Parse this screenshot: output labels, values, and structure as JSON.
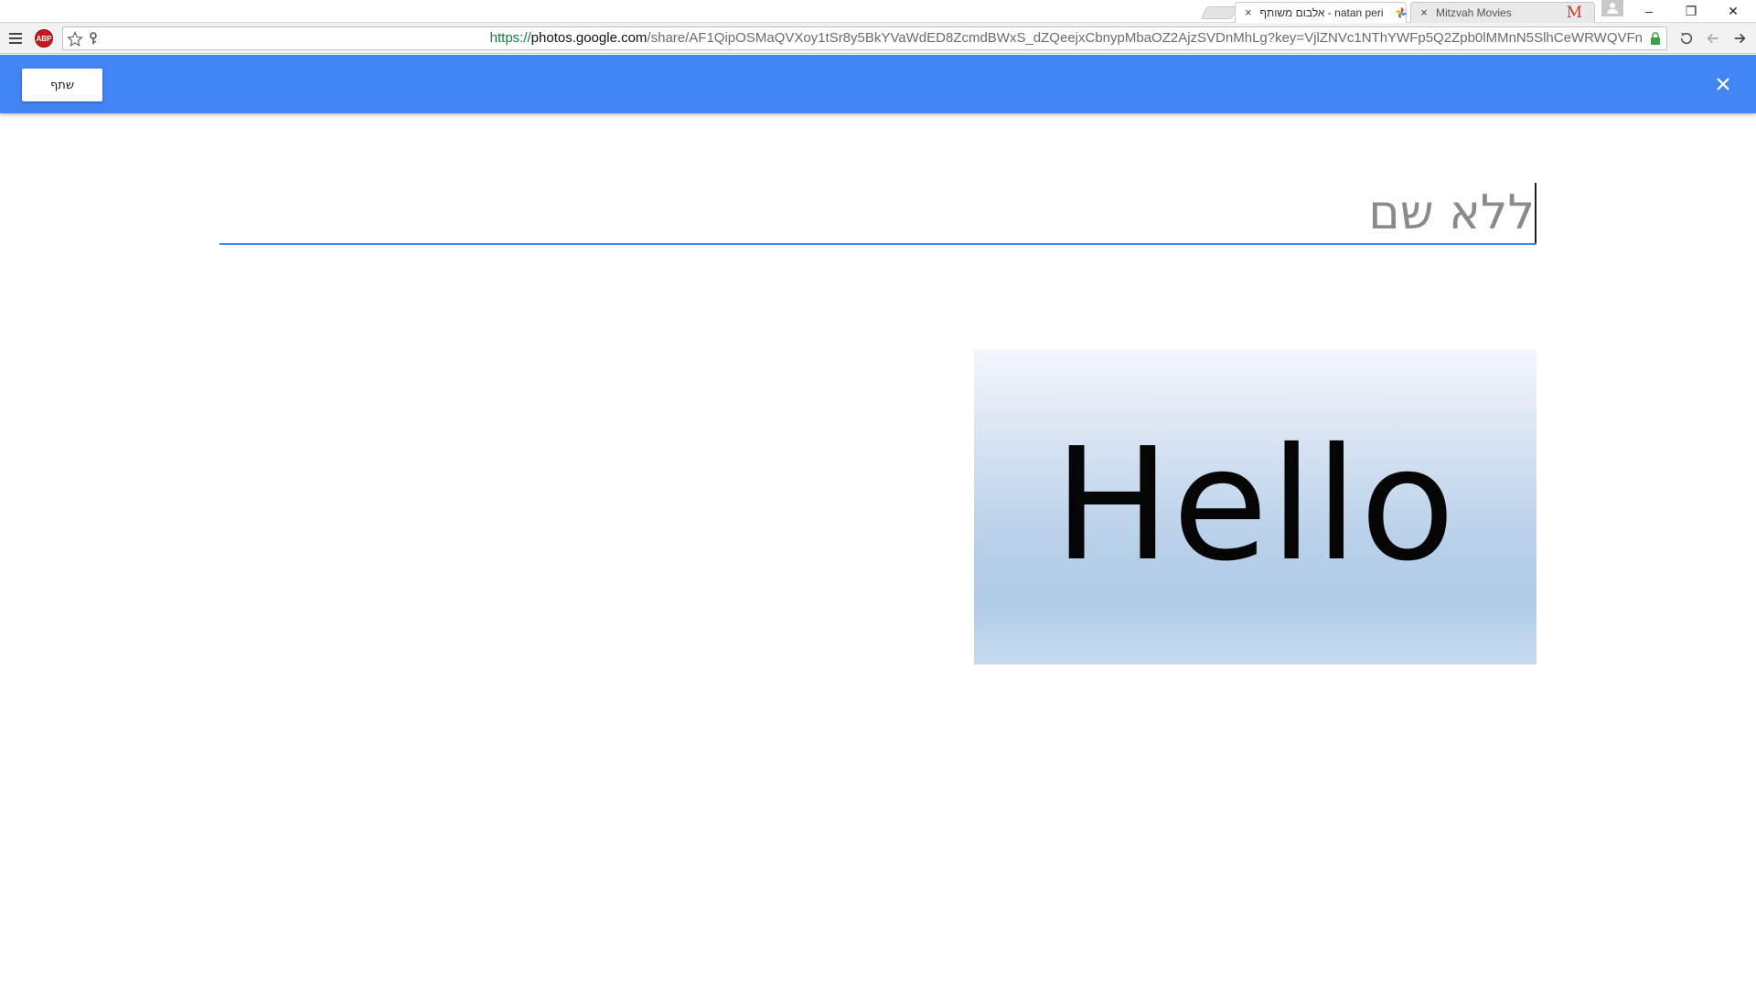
{
  "browser": {
    "tabs": [
      {
        "title": "natan peri - אלבום משותף",
        "active": true,
        "close": "×"
      },
      {
        "title": "Mitzvah Movies",
        "active": false,
        "close": "×",
        "favicon_letter": "M"
      }
    ],
    "window_controls": {
      "minimize": "–",
      "restore": "❐",
      "close": "✕"
    },
    "address": {
      "scheme": "https://",
      "host": "photos.google.com",
      "path": "/share/AF1QipOSMaQVXoy1tSr8y5BkYVaWdED8ZcmdBWxS_dZQeejxCbnypMbaOZ2AjzSVDnMhLg?key=VjlZNVc1NThYWFp5Q2Zpb0lMMnN5SlhCeWRWQVFn"
    },
    "extension_label": "ABP",
    "colors": {
      "secure_scheme": "#0b8043",
      "lock": "#3aa14a"
    }
  },
  "appbar": {
    "share_label": "שתף",
    "close_icon": "close-icon",
    "color": "#4285f4"
  },
  "album": {
    "title_placeholder": "ללא שם",
    "title_value": "",
    "underline_color": "#4285f4"
  },
  "photos": [
    {
      "caption_text": "Hello"
    }
  ]
}
